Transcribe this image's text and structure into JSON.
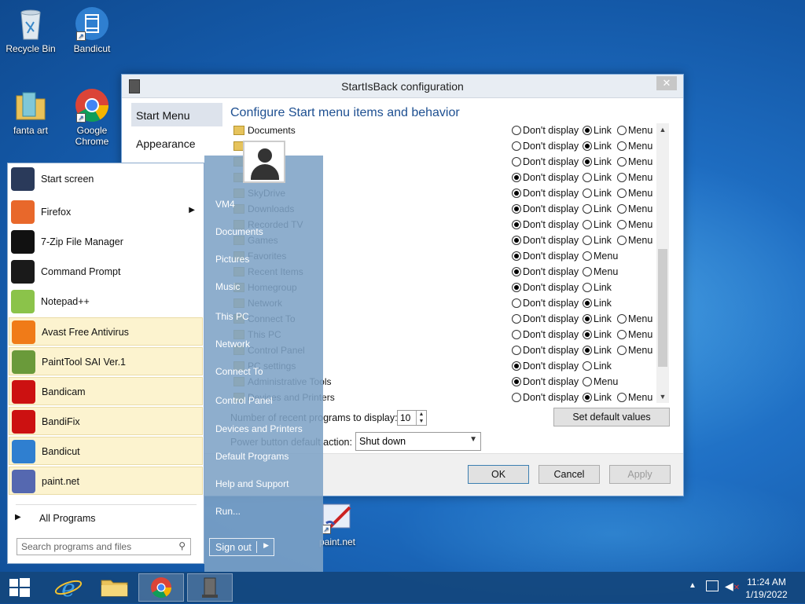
{
  "desktop": {
    "icons": [
      {
        "label": "Recycle Bin"
      },
      {
        "label": "Bandicut"
      },
      {
        "label": "fanta art"
      },
      {
        "label": "Google Chrome"
      },
      {
        "label": "paint.net"
      }
    ]
  },
  "dialog": {
    "title": "StartIsBack configuration",
    "close_glyph": "✕",
    "nav": [
      "Start Menu",
      "Appearance"
    ],
    "heading": "Configure Start menu items and behavior",
    "items": [
      {
        "label": "Documents",
        "options": [
          "Don't display",
          "Link",
          "Menu"
        ],
        "selected": 1
      },
      {
        "label": "",
        "options": [
          "Don't display",
          "Link",
          "Menu"
        ],
        "selected": 1
      },
      {
        "label": "",
        "options": [
          "Don't display",
          "Link",
          "Menu"
        ],
        "selected": 1
      },
      {
        "label": "",
        "options": [
          "Don't display",
          "Link",
          "Menu"
        ],
        "selected": 0
      },
      {
        "label": "SkyDrive",
        "options": [
          "Don't display",
          "Link",
          "Menu"
        ],
        "selected": 0
      },
      {
        "label": "Downloads",
        "options": [
          "Don't display",
          "Link",
          "Menu"
        ],
        "selected": 0
      },
      {
        "label": "Recorded TV",
        "options": [
          "Don't display",
          "Link",
          "Menu"
        ],
        "selected": 0
      },
      {
        "label": "Games",
        "options": [
          "Don't display",
          "Link",
          "Menu"
        ],
        "selected": 0
      },
      {
        "label": "Favorites",
        "options": [
          "Don't display",
          "Menu"
        ],
        "selected": 0
      },
      {
        "label": "Recent Items",
        "options": [
          "Don't display",
          "Menu"
        ],
        "selected": 0
      },
      {
        "label": "Homegroup",
        "options": [
          "Don't display",
          "Link"
        ],
        "selected": 0
      },
      {
        "label": "Network",
        "options": [
          "Don't display",
          "Link"
        ],
        "selected": 1
      },
      {
        "label": "Connect To",
        "options": [
          "Don't display",
          "Link",
          "Menu"
        ],
        "selected": 1
      },
      {
        "label": "This PC",
        "options": [
          "Don't display",
          "Link",
          "Menu"
        ],
        "selected": 1
      },
      {
        "label": "Control Panel",
        "options": [
          "Don't display",
          "Link",
          "Menu"
        ],
        "selected": 1
      },
      {
        "label": "PC settings",
        "options": [
          "Don't display",
          "Link"
        ],
        "selected": 0
      },
      {
        "label": "Administrative Tools",
        "options": [
          "Don't display",
          "Menu"
        ],
        "selected": 0
      },
      {
        "label": "Devices and Printers",
        "options": [
          "Don't display",
          "Link",
          "Menu"
        ],
        "selected": 1
      }
    ],
    "recent_label": "Number of recent programs to display:",
    "recent_value": "10",
    "set_default": "Set default values",
    "power_label": "Power button default action:",
    "power_value": "Shut down",
    "ok": "OK",
    "cancel": "Cancel",
    "apply": "Apply"
  },
  "start_menu": {
    "programs": [
      {
        "label": "Start screen",
        "color": "#2a3a5a",
        "arrow": false,
        "highlight": false
      },
      {
        "label": "Firefox",
        "color": "#e8682b",
        "arrow": true,
        "highlight": false
      },
      {
        "label": "7-Zip File Manager",
        "color": "#111111",
        "arrow": false,
        "highlight": false
      },
      {
        "label": "Command Prompt",
        "color": "#1a1a1a",
        "arrow": false,
        "highlight": false
      },
      {
        "label": "Notepad++",
        "color": "#8bc34a",
        "arrow": false,
        "highlight": false
      },
      {
        "label": "Avast Free Antivirus",
        "color": "#f07b18",
        "arrow": false,
        "highlight": true
      },
      {
        "label": "PaintTool SAI Ver.1",
        "color": "#6a9a3a",
        "arrow": false,
        "highlight": true
      },
      {
        "label": "Bandicam",
        "color": "#cc1111",
        "arrow": false,
        "highlight": true
      },
      {
        "label": "BandiFix",
        "color": "#cc1111",
        "arrow": false,
        "highlight": true
      },
      {
        "label": "Bandicut",
        "color": "#2f7fd0",
        "arrow": false,
        "highlight": true
      },
      {
        "label": "paint.net",
        "color": "#5568b0",
        "arrow": false,
        "highlight": true
      }
    ],
    "all_programs": "All Programs",
    "search_placeholder": "Search programs and files",
    "right_items": [
      "VM4",
      "Documents",
      "Pictures",
      "Music",
      "This PC",
      "Network",
      "Connect To",
      "Control Panel",
      "Devices and Printers",
      "Default Programs",
      "Help and Support",
      "Run..."
    ],
    "sign_out": "Sign out"
  },
  "taskbar": {
    "time": "11:24 AM",
    "date": "1/19/2022"
  }
}
